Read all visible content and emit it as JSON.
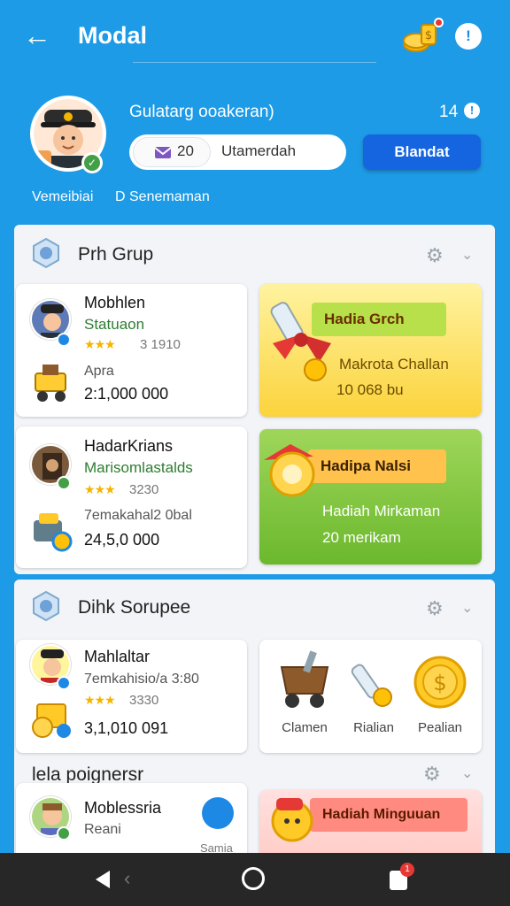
{
  "header": {
    "title": "Modal",
    "back_icon": "arrow-left-icon",
    "coins_icon": "coins-icon",
    "info_icon": "info-icon",
    "info_glyph": "!"
  },
  "profile": {
    "name": "Gulatarg ooakeran)",
    "count": "14",
    "count_icon_glyph": "!",
    "pill_number": "20",
    "pill_text": "Utamerdah",
    "primary_button": "Blandat",
    "sub_left": "Vemeibiai",
    "sub_right": "D Senemaman"
  },
  "section1": {
    "title": "Prh Grup",
    "cards": [
      {
        "name": "Mobhlen",
        "sub": "Statuaon",
        "stars": "★★★",
        "meta": "3 1910",
        "small": "Apra",
        "value": "2:1,000 000"
      },
      {
        "name": "HadarKrians",
        "sub": "Marisomlastalds",
        "stars": "★★★",
        "meta": "3230",
        "small": "7emakahal2 0bal",
        "value": "24,5,0 000"
      }
    ],
    "promos": [
      {
        "ribbon": "Hadia Grch",
        "line1": "Makrota Challan",
        "line2": "10 068 bu"
      },
      {
        "ribbon": "Hadipa Nalsi",
        "line1": "Hadiah Mirkaman",
        "line2": "20 merikam"
      }
    ]
  },
  "section2": {
    "title": "Dihk Sorupee",
    "card": {
      "name": "Mahlaltar",
      "sub": "7emkahisio/a 3:80",
      "stars": "★★★",
      "meta": "3330",
      "value": "3,1,010 091"
    },
    "shop": [
      {
        "label": "Clamen",
        "icon": "cart-icon"
      },
      {
        "label": "Rialian",
        "icon": "bottle-icon"
      },
      {
        "label": "Pealian",
        "icon": "coin-icon"
      }
    ]
  },
  "section3": {
    "title": "lela poignersr",
    "card": {
      "name": "Moblessria",
      "sub": "Reani",
      "action_label": "Samia"
    },
    "promo": {
      "ribbon": "Hadiah Minguuan"
    }
  },
  "nav": {
    "badge": "1"
  },
  "colors": {
    "background": "#1e9be6",
    "primary_button": "#1565e0",
    "nav": "#272727"
  }
}
